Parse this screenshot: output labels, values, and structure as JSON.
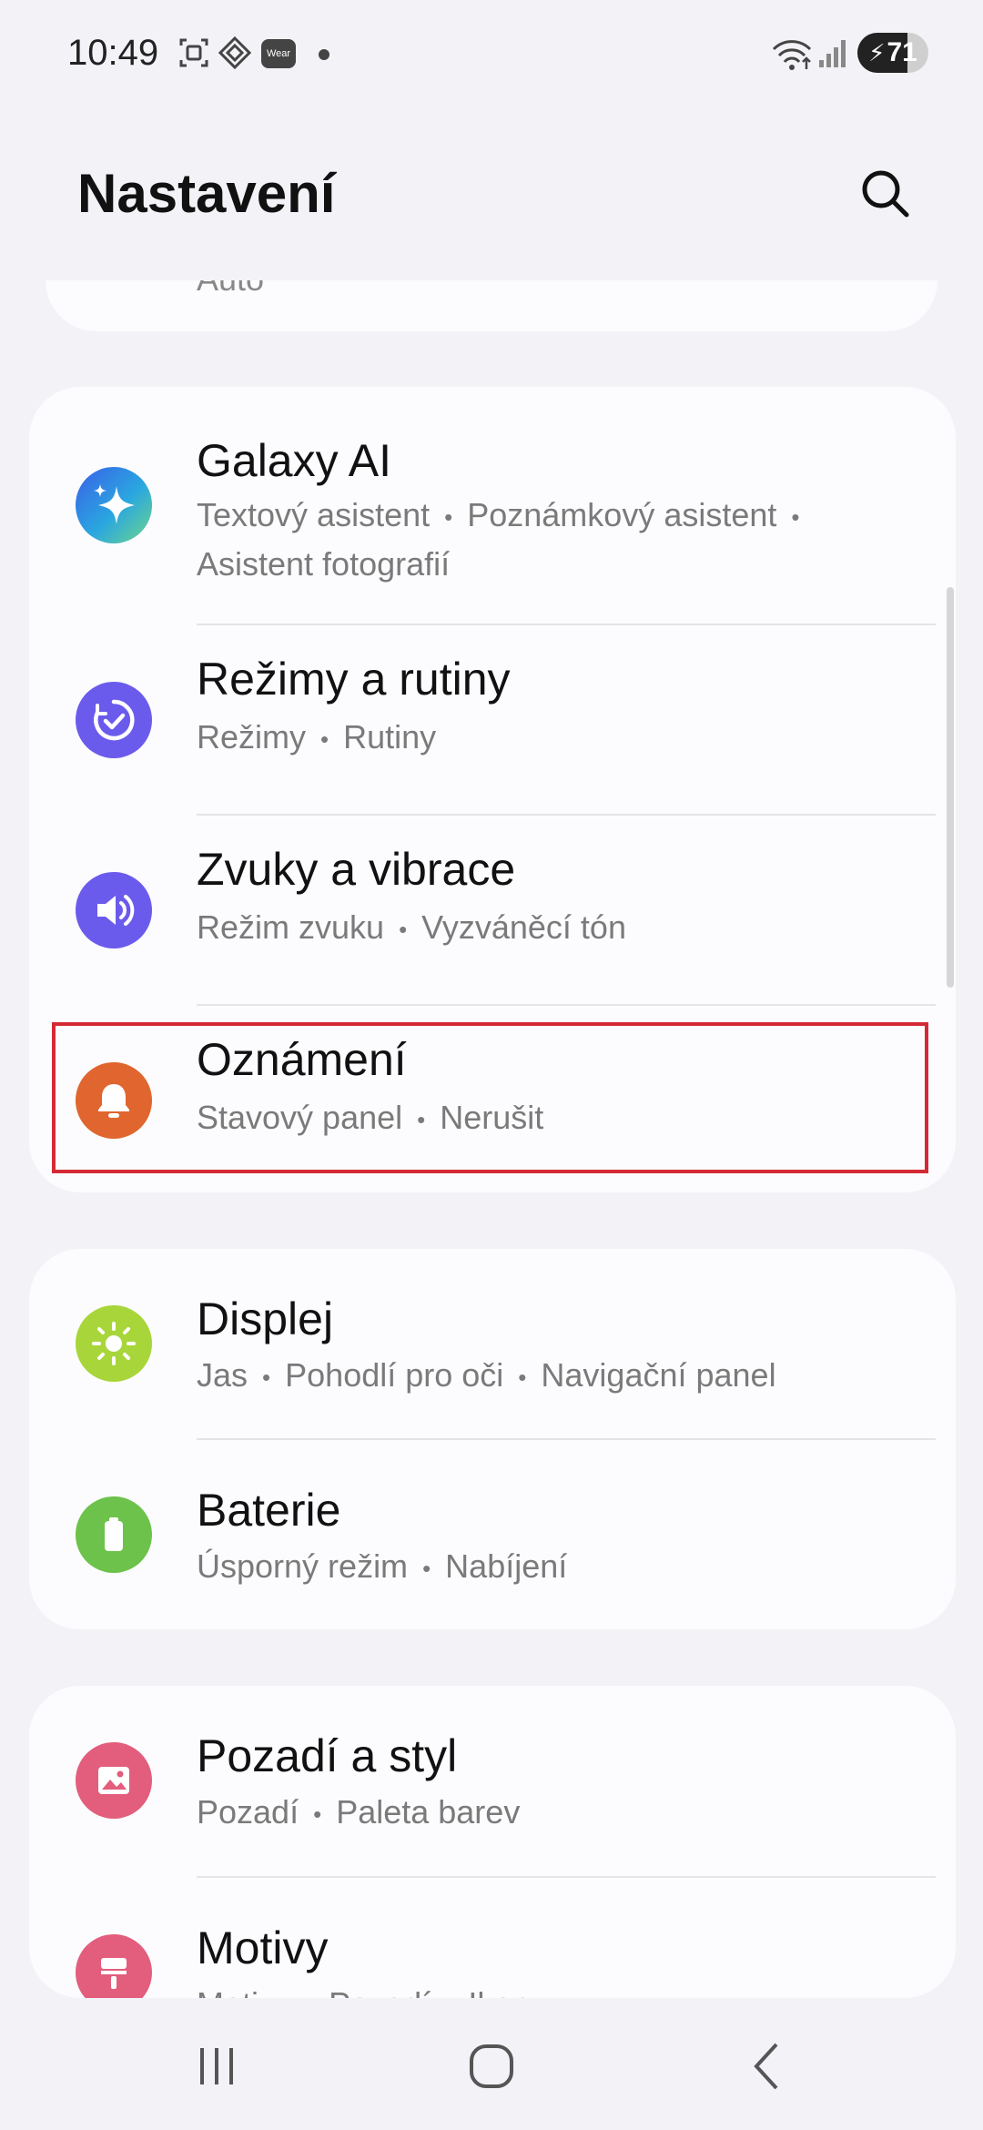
{
  "status": {
    "time": "10:49",
    "wear_badge": "Wear",
    "battery": "71",
    "battery_level": 0.71
  },
  "header": {
    "title": "Nastavení"
  },
  "cut_item": {
    "subtitle": "Auto"
  },
  "cards": [
    {
      "items": [
        {
          "title": "Galaxy AI",
          "sub": [
            "Textový asistent",
            "Poznámkový asistent",
            "Asistent fotografií"
          ],
          "icon": "sparkle-icon",
          "color": "#3b6fe0"
        },
        {
          "title": "Režimy a rutiny",
          "sub": [
            "Režimy",
            "Rutiny"
          ],
          "icon": "check-circle-icon",
          "color": "#6b5bec"
        },
        {
          "title": "Zvuky a vibrace",
          "sub": [
            "Režim zvuku",
            "Vyzváněcí tón"
          ],
          "icon": "speaker-icon",
          "color": "#6b5bec"
        },
        {
          "title": "Oznámení",
          "sub": [
            "Stavový panel",
            "Nerušit"
          ],
          "icon": "bell-icon",
          "color": "#e0652e"
        }
      ]
    },
    {
      "items": [
        {
          "title": "Displej",
          "sub": [
            "Jas",
            "Pohodlí pro oči",
            "Navigační panel"
          ],
          "icon": "sun-icon",
          "color": "#a8d63a"
        },
        {
          "title": "Baterie",
          "sub": [
            "Úsporný režim",
            "Nabíjení"
          ],
          "icon": "battery-icon",
          "color": "#6cc24a"
        }
      ]
    },
    {
      "items": [
        {
          "title": "Pozadí a styl",
          "sub": [
            "Pozadí",
            "Paleta barev"
          ],
          "icon": "image-icon",
          "color": "#e35d7c"
        },
        {
          "title": "Motivy",
          "sub": [
            "Motivy",
            "Pozadí",
            "Ikony"
          ],
          "icon": "brush-icon",
          "color": "#e35d7c"
        }
      ]
    }
  ],
  "highlight_color": "#d42a35"
}
